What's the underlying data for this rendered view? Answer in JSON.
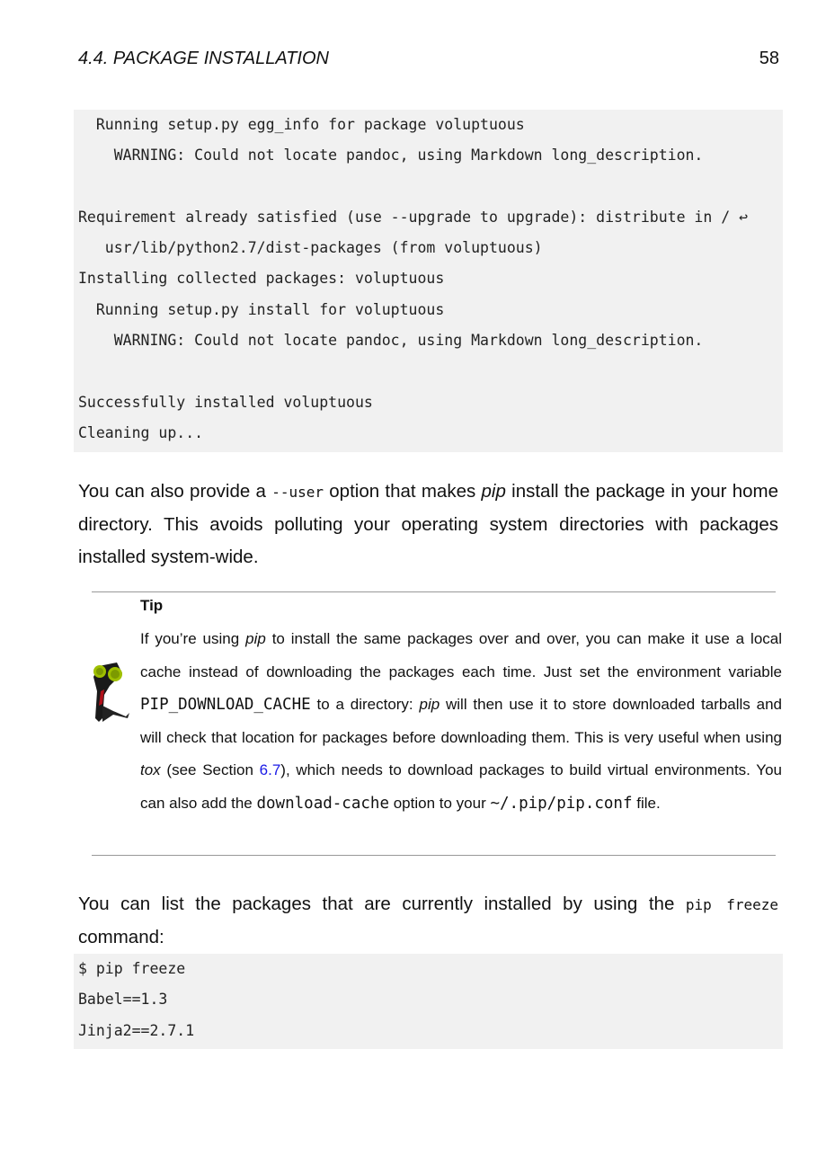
{
  "header": {
    "section": "4.4.  PACKAGE INSTALLATION",
    "page": "58"
  },
  "code1": [
    "  Running setup.py egg_info for package voluptuous",
    "    WARNING: Could not locate pandoc, using Markdown long_description.",
    "",
    "Requirement already satisfied (use --upgrade to upgrade): distribute in / ↩",
    "   usr/lib/python2.7/dist-packages (from voluptuous)",
    "Installing collected packages: voluptuous",
    "  Running setup.py install for voluptuous",
    "    WARNING: Could not locate pandoc, using Markdown long_description.",
    "",
    "Successfully installed voluptuous",
    "Cleaning up..."
  ],
  "para1": {
    "a": "You can also provide a ",
    "code": "--user",
    "b": " option that makes ",
    "em": "pip",
    "c": " install the package in your home directory. This avoids polluting your operating system directories with packages installed system-wide."
  },
  "tip": {
    "title": "Tip",
    "t1": "If you’re using ",
    "em1": "pip",
    "t2": " to install the same packages over and over, you can make it use a local cache instead of downloading the packages each time.  Just set the environment variable ",
    "code1": "PIP_DOWNLOAD_CACHE",
    "t3": " to a directory: ",
    "em2": "pip",
    "t4": " will then use it to store downloaded tarballs and will check that location for packages before downloading them.  This is very useful when using ",
    "em3": "tox",
    "t5": " (see Section ",
    "link": "6.7",
    "t6": "), which needs to download packages to build virtual environments.  You can also add the ",
    "code2": "download-cache",
    "t7": " option to your ",
    "code3": "~/.pip/pip.conf",
    "t8": " file."
  },
  "para2": {
    "a": "You can list the packages that are currently installed by using the ",
    "code": "pip freeze",
    "b": " command:"
  },
  "code2": [
    "$ pip freeze",
    "Babel==1.3",
    "Jinja2==2.7.1"
  ]
}
